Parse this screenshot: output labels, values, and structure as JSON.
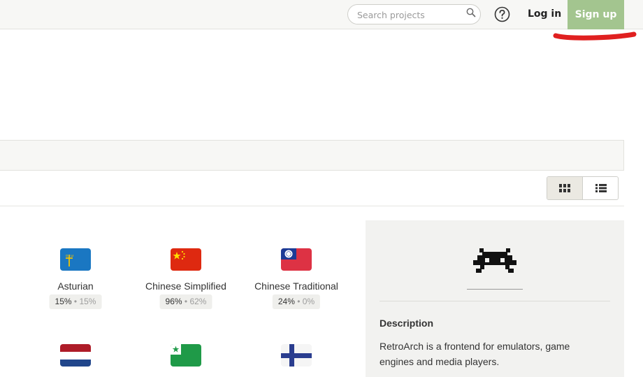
{
  "header": {
    "search_placeholder": "Search projects",
    "login_label": "Log in",
    "signup_label": "Sign up"
  },
  "view_toggle": {
    "active": "grid"
  },
  "languages": [
    {
      "name": "Asturian",
      "primary": "15%",
      "secondary": "15%",
      "flag": "asturias-flag-icon"
    },
    {
      "name": "Chinese Simplified",
      "primary": "96%",
      "secondary": "62%",
      "flag": "china-flag-icon"
    },
    {
      "name": "Chinese Traditional",
      "primary": "24%",
      "secondary": "0%",
      "flag": "taiwan-flag-icon"
    },
    {
      "name": "",
      "primary": "",
      "secondary": "",
      "flag": "netherlands-flag-icon"
    },
    {
      "name": "",
      "primary": "",
      "secondary": "",
      "flag": "esperanto-flag-icon"
    },
    {
      "name": "",
      "primary": "",
      "secondary": "",
      "flag": "finland-flag-icon"
    }
  ],
  "stats_separator": "•",
  "project": {
    "description_title": "Description",
    "description": "RetroArch is a frontend for emulators, game engines and media players."
  },
  "colors": {
    "signup": "#a3c58f",
    "annotation": "#e02020"
  }
}
